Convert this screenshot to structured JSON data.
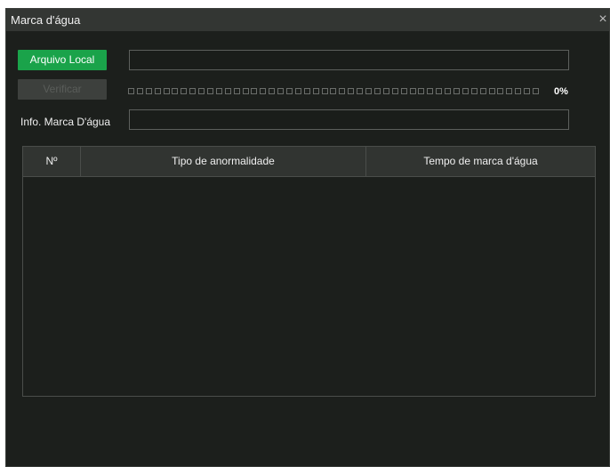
{
  "dialog": {
    "title": "Marca d'água",
    "close_glyph": "×"
  },
  "actions": {
    "local_file_label": "Arquivo Local",
    "verify_label": "Verificar",
    "file_path_value": ""
  },
  "progress": {
    "percent_text": "0%",
    "percent_value": 0,
    "segments": 47
  },
  "watermark_info": {
    "label": "Info. Marca D'água",
    "value": ""
  },
  "table": {
    "columns": [
      "Nº",
      "Tipo de anormalidade",
      "Tempo de marca d'água"
    ],
    "rows": []
  },
  "colors": {
    "accent": "#1aa34a",
    "background": "#1c1f1c",
    "titlebar": "#333633"
  },
  "icons": {
    "close": "close-icon"
  }
}
